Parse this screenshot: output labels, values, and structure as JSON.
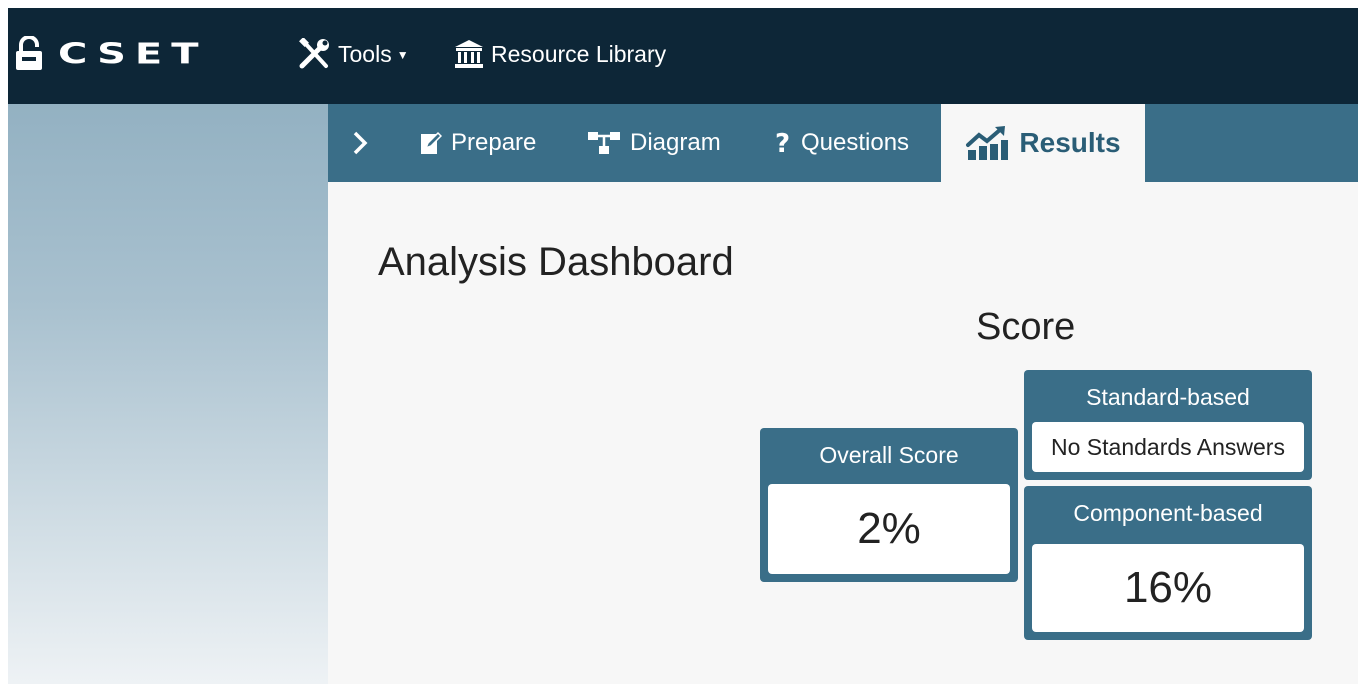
{
  "header": {
    "brand": "CSET",
    "menu": {
      "tools_label": "Tools",
      "resource_library_label": "Resource Library"
    }
  },
  "tabs": [
    {
      "label": "Prepare",
      "icon": "edit-icon"
    },
    {
      "label": "Diagram",
      "icon": "sitemap-icon"
    },
    {
      "label": "Questions",
      "icon": "question-icon"
    },
    {
      "label": "Results",
      "icon": "chart-icon",
      "active": true
    }
  ],
  "main": {
    "title": "Analysis Dashboard",
    "score_heading": "Score",
    "overall": {
      "title": "Overall Score",
      "value": "2%"
    },
    "standard": {
      "title": "Standard-based",
      "value": "No Standards Answers"
    },
    "component": {
      "title": "Component-based",
      "value": "16%"
    }
  },
  "colors": {
    "navbar": "#0d2637",
    "tabbar": "#3a6e88",
    "accent": "#2a5d76",
    "background": "#f7f7f7"
  }
}
